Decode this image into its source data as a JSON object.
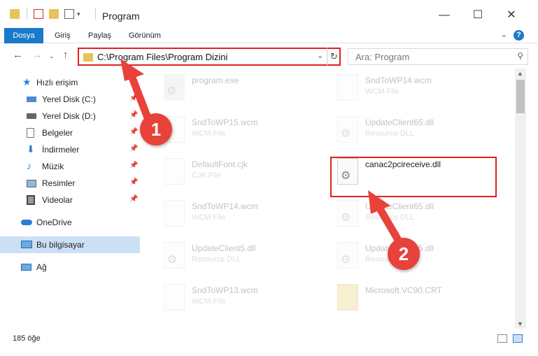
{
  "window": {
    "title": "Program",
    "controls": {
      "minimize": "—",
      "maximize": "☐",
      "close": "✕"
    }
  },
  "ribbon": {
    "tabs": [
      "Dosya",
      "Giriş",
      "Paylaş",
      "Görünüm"
    ],
    "help": "?"
  },
  "address": {
    "path": "C:\\Program Files\\Program Dizini",
    "search_placeholder": "Ara: Program"
  },
  "sidebar": {
    "quick_access": "Hızlı erişim",
    "pinned": [
      {
        "label": "Yerel Disk (C:)",
        "icon": "drive-icon"
      },
      {
        "label": "Yerel Disk (D:)",
        "icon": "drive-icon"
      },
      {
        "label": "Belgeler",
        "icon": "documents-icon"
      },
      {
        "label": "İndirmeler",
        "icon": "download-icon"
      },
      {
        "label": "Müzik",
        "icon": "music-icon"
      },
      {
        "label": "Resimler",
        "icon": "pictures-icon"
      },
      {
        "label": "Videolar",
        "icon": "videos-icon"
      }
    ],
    "onedrive": "OneDrive",
    "this_pc": "Bu bilgisayar",
    "network": "Ağ"
  },
  "files": {
    "left": [
      {
        "name": "program.exe",
        "type": ""
      },
      {
        "name": "SndToWP15.wcm",
        "type": "WCM File"
      },
      {
        "name": "DefaultFont.cjk",
        "type": "CJK File"
      },
      {
        "name": "SndToWP14.wcm",
        "type": "WCM File"
      },
      {
        "name": "UpdateClient5.dll",
        "type": "Resource DLL"
      },
      {
        "name": "SndToWP13.wcm",
        "type": "WCM File"
      }
    ],
    "right": [
      {
        "name": "SndToWP14.wcm",
        "type": "WCM File"
      },
      {
        "name": "UpdateClient65.dll",
        "type": "Resource DLL"
      },
      {
        "name": "canac2pcireceive.dll",
        "type": ""
      },
      {
        "name": "UpdateClient65.dll",
        "type": "Resource DLL"
      },
      {
        "name": "UpdateClient65.dll",
        "type": "Resource DLL"
      },
      {
        "name": "Microsoft.VC90.CRT",
        "type": ""
      }
    ]
  },
  "status": {
    "count": "185 öğe"
  },
  "annotations": {
    "step1": "1",
    "step2": "2",
    "color": "#e8423b"
  }
}
